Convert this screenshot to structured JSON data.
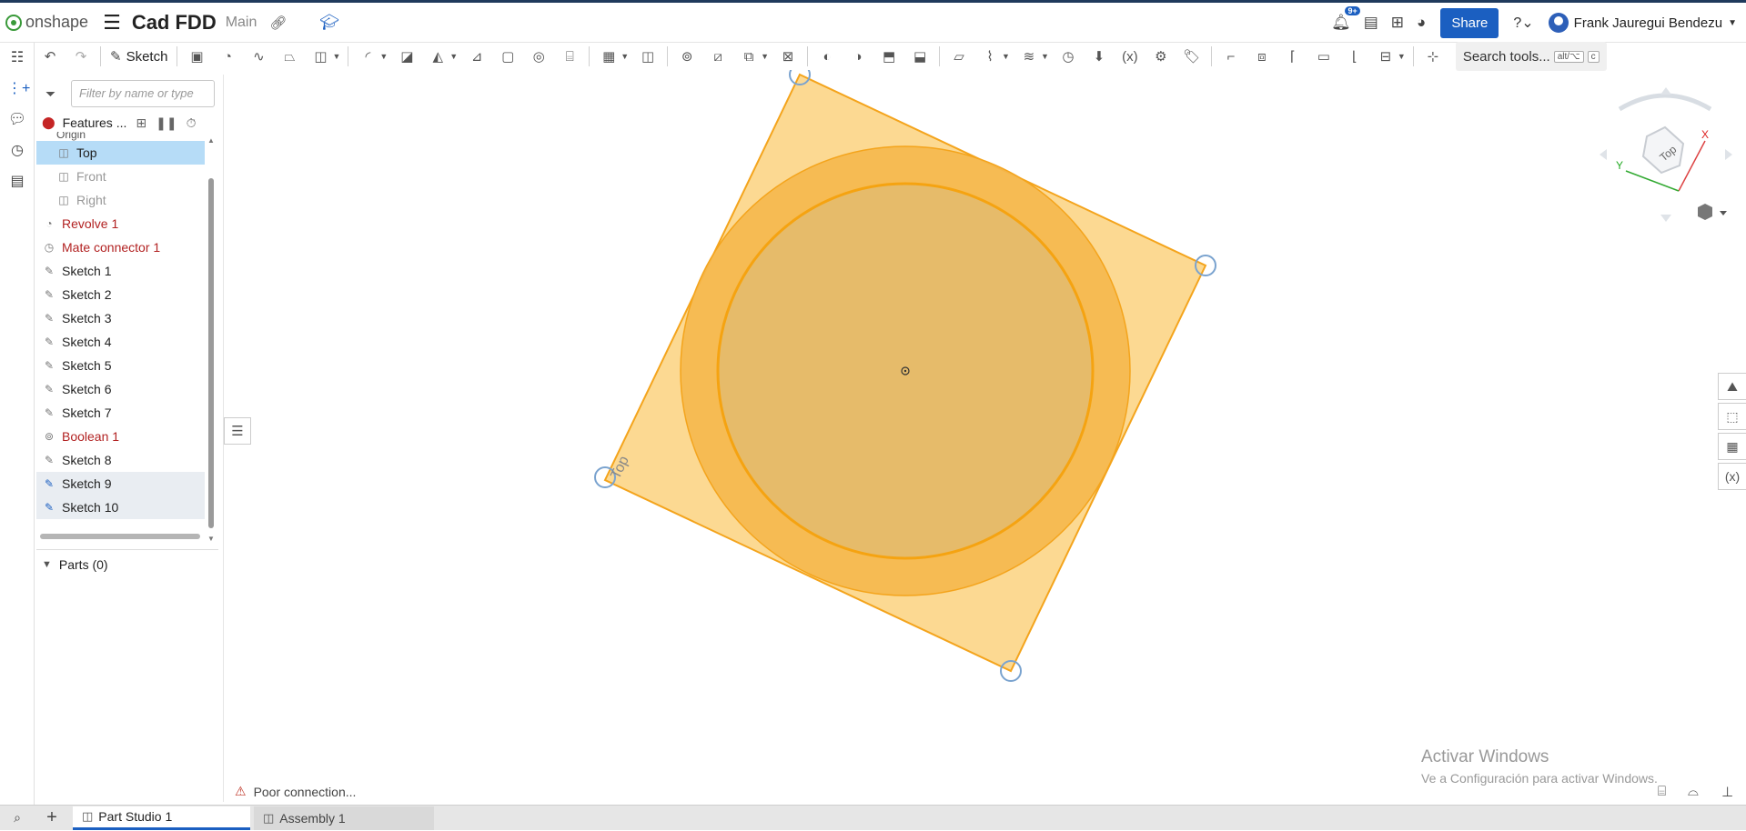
{
  "header": {
    "logo_text": "onshape",
    "doc_title": "Cad FDD",
    "workspace": "Main",
    "notifications_badge": "9+",
    "share_label": "Share",
    "user_name": "Frank Jauregui Bendezu"
  },
  "toolbar": {
    "sketch_label": "Sketch",
    "search_label": "Search tools...",
    "search_shortcut_1": "alt/⌥",
    "search_shortcut_2": "c"
  },
  "feature_tree": {
    "filter_placeholder": "Filter by name or type",
    "header_label": "Features ...",
    "items": [
      {
        "label": "Origin",
        "state": "normal"
      },
      {
        "label": "Top",
        "state": "selected"
      },
      {
        "label": "Front",
        "state": "dim"
      },
      {
        "label": "Right",
        "state": "dim"
      },
      {
        "label": "Revolve 1",
        "state": "error"
      },
      {
        "label": "Mate connector 1",
        "state": "error"
      },
      {
        "label": "Sketch 1",
        "state": "normal"
      },
      {
        "label": "Sketch 2",
        "state": "normal"
      },
      {
        "label": "Sketch 3",
        "state": "normal"
      },
      {
        "label": "Sketch 4",
        "state": "normal"
      },
      {
        "label": "Sketch 5",
        "state": "normal"
      },
      {
        "label": "Sketch 6",
        "state": "normal"
      },
      {
        "label": "Sketch 7",
        "state": "normal"
      },
      {
        "label": "Boolean 1",
        "state": "error"
      },
      {
        "label": "Sketch 8",
        "state": "normal"
      },
      {
        "label": "Sketch 9",
        "state": "highlight"
      },
      {
        "label": "Sketch 10",
        "state": "highlight"
      }
    ],
    "parts_label": "Parts (0)"
  },
  "viewport": {
    "plane_label": "Top",
    "cube_label": "Top",
    "axis_x": "X",
    "axis_y": "Y",
    "colors": {
      "plane_fill": "#fcd27f",
      "plane_edge": "#f4a41c",
      "outer_circle": "#f5b74c",
      "inner_circle": "#e6bb6a",
      "handle": "#7aa3cf"
    }
  },
  "status": {
    "connection": "Poor connection..."
  },
  "watermark": {
    "line1": "Activar Windows",
    "line2": "Ve a Configuración para activar Windows."
  },
  "tabs": [
    {
      "label": "Part Studio 1",
      "active": true
    },
    {
      "label": "Assembly 1",
      "active": false
    }
  ]
}
